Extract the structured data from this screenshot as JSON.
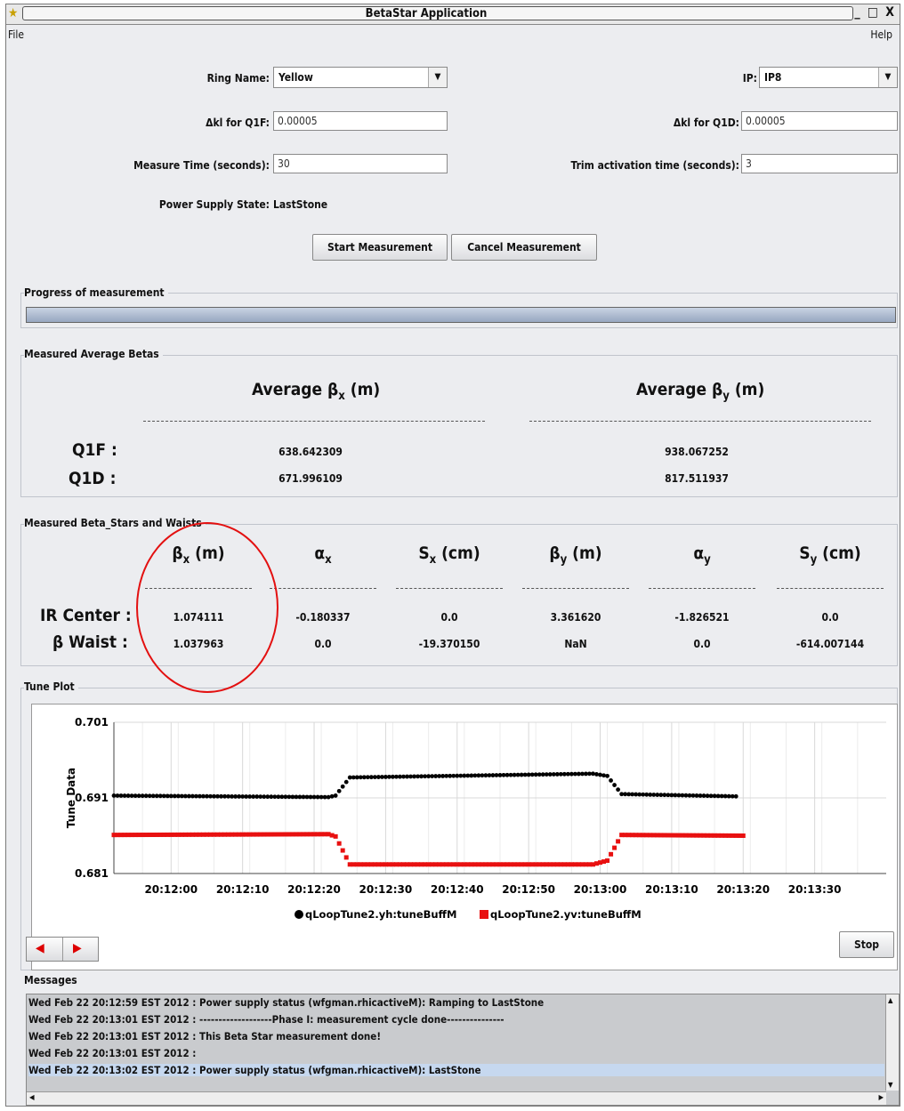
{
  "window": {
    "title": "BetaStar Application",
    "controls": "_ □ X"
  },
  "menu": {
    "file": "File",
    "help": "Help"
  },
  "form": {
    "ring_name_label": "Ring Name:",
    "ring_name_value": "Yellow",
    "ip_label": "IP:",
    "ip_value": "IP8",
    "dkl_q1f_label": "Δkl for Q1F:",
    "dkl_q1f_value": "0.00005",
    "dkl_q1d_label": "Δkl for Q1D:",
    "dkl_q1d_value": "0.00005",
    "measure_time_label": "Measure Time (seconds):",
    "measure_time_value": "30",
    "trim_time_label": "Trim activation time (seconds):",
    "trim_time_value": "3",
    "psu_state_label": "Power Supply State:",
    "psu_state_value": "LastStone"
  },
  "buttons": {
    "start": "Start Measurement",
    "cancel": "Cancel Measurement",
    "stop": "Stop"
  },
  "progress": {
    "title": "Progress of measurement",
    "fraction": 1.0
  },
  "avg_betas": {
    "title": "Measured Average Betas",
    "col_x": "Average β",
    "col_x_sub": "x",
    "col_x_unit": " (m)",
    "col_y": "Average β",
    "col_y_sub": "y",
    "col_y_unit": " (m)",
    "rows": [
      {
        "label": "Q1F :",
        "bx": "638.642309",
        "by": "938.067252"
      },
      {
        "label": "Q1D :",
        "bx": "671.996109",
        "by": "817.511937"
      }
    ]
  },
  "beta_stars": {
    "title": "Measured Beta_Stars and Waists",
    "headers": [
      {
        "sym": "β",
        "sub": "x",
        "unit": " (m)"
      },
      {
        "sym": "α",
        "sub": "x",
        "unit": ""
      },
      {
        "sym": "S",
        "sub": "x",
        "unit": " (cm)"
      },
      {
        "sym": "β",
        "sub": "y",
        "unit": " (m)"
      },
      {
        "sym": "α",
        "sub": "y",
        "unit": ""
      },
      {
        "sym": "S",
        "sub": "y",
        "unit": " (cm)"
      }
    ],
    "rows": [
      {
        "label": "IR Center :",
        "values": [
          "1.074111",
          "-0.180337",
          "0.0",
          "3.361620",
          "-1.826521",
          "0.0"
        ]
      },
      {
        "label": "β Waist :",
        "values": [
          "1.037963",
          "0.0",
          "-19.370150",
          "NaN",
          "0.0",
          "-614.007144"
        ]
      }
    ]
  },
  "tune_plot": {
    "title": "Tune Plot"
  },
  "chart_data": {
    "type": "scatter",
    "ylabel": "Tune Data",
    "ylim": [
      0.681,
      0.701
    ],
    "yticks": [
      "0.681",
      "0.691",
      "0.701"
    ],
    "xticks": [
      "20:12:00",
      "20:12:10",
      "20:12:20",
      "20:12:30",
      "20:12:40",
      "20:12:50",
      "20:13:00",
      "20:13:10",
      "20:13:20",
      "20:13:30"
    ],
    "series": [
      {
        "name": "qLoopTune2.yh:tuneBuffM",
        "color": "#000000",
        "marker": "circle",
        "x": [
          "20:11:52",
          "20:12:22",
          "20:12:23",
          "20:12:25",
          "20:12:59",
          "20:13:01",
          "20:13:03",
          "20:13:19"
        ],
        "y": [
          0.6913,
          0.6911,
          0.6913,
          0.6937,
          0.6942,
          0.6939,
          0.6915,
          0.6912
        ]
      },
      {
        "name": "qLoopTune2.yv:tuneBuffM",
        "color": "#e81010",
        "marker": "square",
        "x": [
          "20:11:52",
          "20:12:22",
          "20:12:23",
          "20:12:25",
          "20:12:59",
          "20:13:01",
          "20:13:03",
          "20:13:20"
        ],
        "y": [
          0.6861,
          0.6862,
          0.6859,
          0.6822,
          0.6822,
          0.6827,
          0.6861,
          0.686
        ]
      }
    ]
  },
  "messages": {
    "title": "Messages",
    "lines": [
      "Wed Feb 22 20:12:59 EST 2012 : Power supply status (wfgman.rhicactiveM): Ramping to LastStone",
      "Wed Feb 22 20:13:01 EST 2012 : -------------------Phase I: measurement cycle done---------------",
      "Wed Feb 22 20:13:01 EST 2012 : This Beta Star measurement done!",
      "Wed Feb 22 20:13:01 EST 2012 :",
      "Wed Feb 22 20:13:02 EST 2012 : Power supply status (wfgman.rhicactiveM): LastStone"
    ]
  },
  "colors": {
    "window_bg": "#ecedf0",
    "accent_red": "#e31010",
    "progress": "#97a7c0",
    "selected_row": "#c6d8ef"
  }
}
